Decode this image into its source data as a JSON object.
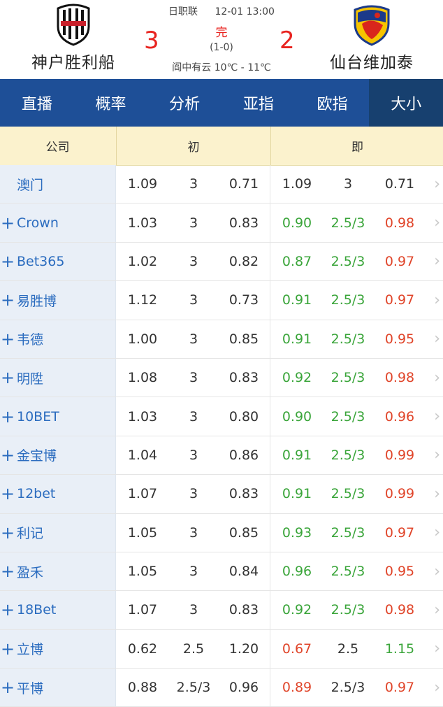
{
  "match": {
    "league": "日职联",
    "datetime": "12-01 13:00",
    "home_team": "神户胜利船",
    "away_team": "仙台维加泰",
    "home_score": "3",
    "away_score": "2",
    "status": "完",
    "halftime": "(1-0)",
    "weather": "阎中有云 10℃ - 11℃"
  },
  "tabs": [
    {
      "label": "直播"
    },
    {
      "label": "概率"
    },
    {
      "label": "分析"
    },
    {
      "label": "亚指"
    },
    {
      "label": "欧指"
    },
    {
      "label": "大小",
      "active": true
    }
  ],
  "table_header": {
    "company": "公司",
    "initial": "初",
    "live": "即"
  },
  "rows": [
    {
      "plus": false,
      "company": "澳门",
      "init": [
        "1.09",
        "3",
        "0.71"
      ],
      "live": [
        "1.09",
        "3",
        "0.71"
      ],
      "live_colors": [
        "neutral",
        "neutral",
        "neutral"
      ]
    },
    {
      "plus": true,
      "company": "Crown",
      "init": [
        "1.03",
        "3",
        "0.83"
      ],
      "live": [
        "0.90",
        "2.5/3",
        "0.98"
      ],
      "live_colors": [
        "green",
        "green",
        "red"
      ]
    },
    {
      "plus": true,
      "company": "Bet365",
      "init": [
        "1.02",
        "3",
        "0.82"
      ],
      "live": [
        "0.87",
        "2.5/3",
        "0.97"
      ],
      "live_colors": [
        "green",
        "green",
        "red"
      ]
    },
    {
      "plus": true,
      "company": "易胜博",
      "init": [
        "1.12",
        "3",
        "0.73"
      ],
      "live": [
        "0.91",
        "2.5/3",
        "0.97"
      ],
      "live_colors": [
        "green",
        "green",
        "red"
      ]
    },
    {
      "plus": true,
      "company": "韦德",
      "init": [
        "1.00",
        "3",
        "0.85"
      ],
      "live": [
        "0.91",
        "2.5/3",
        "0.95"
      ],
      "live_colors": [
        "green",
        "green",
        "red"
      ]
    },
    {
      "plus": true,
      "company": "明陞",
      "init": [
        "1.08",
        "3",
        "0.83"
      ],
      "live": [
        "0.92",
        "2.5/3",
        "0.98"
      ],
      "live_colors": [
        "green",
        "green",
        "red"
      ]
    },
    {
      "plus": true,
      "company": "10BET",
      "init": [
        "1.03",
        "3",
        "0.80"
      ],
      "live": [
        "0.90",
        "2.5/3",
        "0.96"
      ],
      "live_colors": [
        "green",
        "green",
        "red"
      ]
    },
    {
      "plus": true,
      "company": "金宝博",
      "init": [
        "1.04",
        "3",
        "0.86"
      ],
      "live": [
        "0.91",
        "2.5/3",
        "0.99"
      ],
      "live_colors": [
        "green",
        "green",
        "red"
      ]
    },
    {
      "plus": true,
      "company": "12bet",
      "init": [
        "1.07",
        "3",
        "0.83"
      ],
      "live": [
        "0.91",
        "2.5/3",
        "0.99"
      ],
      "live_colors": [
        "green",
        "green",
        "red"
      ]
    },
    {
      "plus": true,
      "company": "利记",
      "init": [
        "1.05",
        "3",
        "0.85"
      ],
      "live": [
        "0.93",
        "2.5/3",
        "0.97"
      ],
      "live_colors": [
        "green",
        "green",
        "red"
      ]
    },
    {
      "plus": true,
      "company": "盈禾",
      "init": [
        "1.05",
        "3",
        "0.84"
      ],
      "live": [
        "0.96",
        "2.5/3",
        "0.95"
      ],
      "live_colors": [
        "green",
        "green",
        "red"
      ]
    },
    {
      "plus": true,
      "company": "18Bet",
      "init": [
        "1.07",
        "3",
        "0.83"
      ],
      "live": [
        "0.92",
        "2.5/3",
        "0.98"
      ],
      "live_colors": [
        "green",
        "green",
        "red"
      ]
    },
    {
      "plus": true,
      "company": "立博",
      "init": [
        "0.62",
        "2.5",
        "1.20"
      ],
      "live": [
        "0.67",
        "2.5",
        "1.15"
      ],
      "live_colors": [
        "red",
        "neutral",
        "green"
      ]
    },
    {
      "plus": true,
      "company": "平博",
      "init": [
        "0.88",
        "2.5/3",
        "0.96"
      ],
      "live": [
        "0.89",
        "2.5/3",
        "0.97"
      ],
      "live_colors": [
        "red",
        "neutral",
        "red"
      ]
    }
  ],
  "colors": {
    "tab_bar": "#1e4f97",
    "tab_active": "#17406f",
    "score": "#e8231f",
    "up": "#e0452a",
    "down": "#3aa53a",
    "company_text": "#2b6cbf"
  }
}
